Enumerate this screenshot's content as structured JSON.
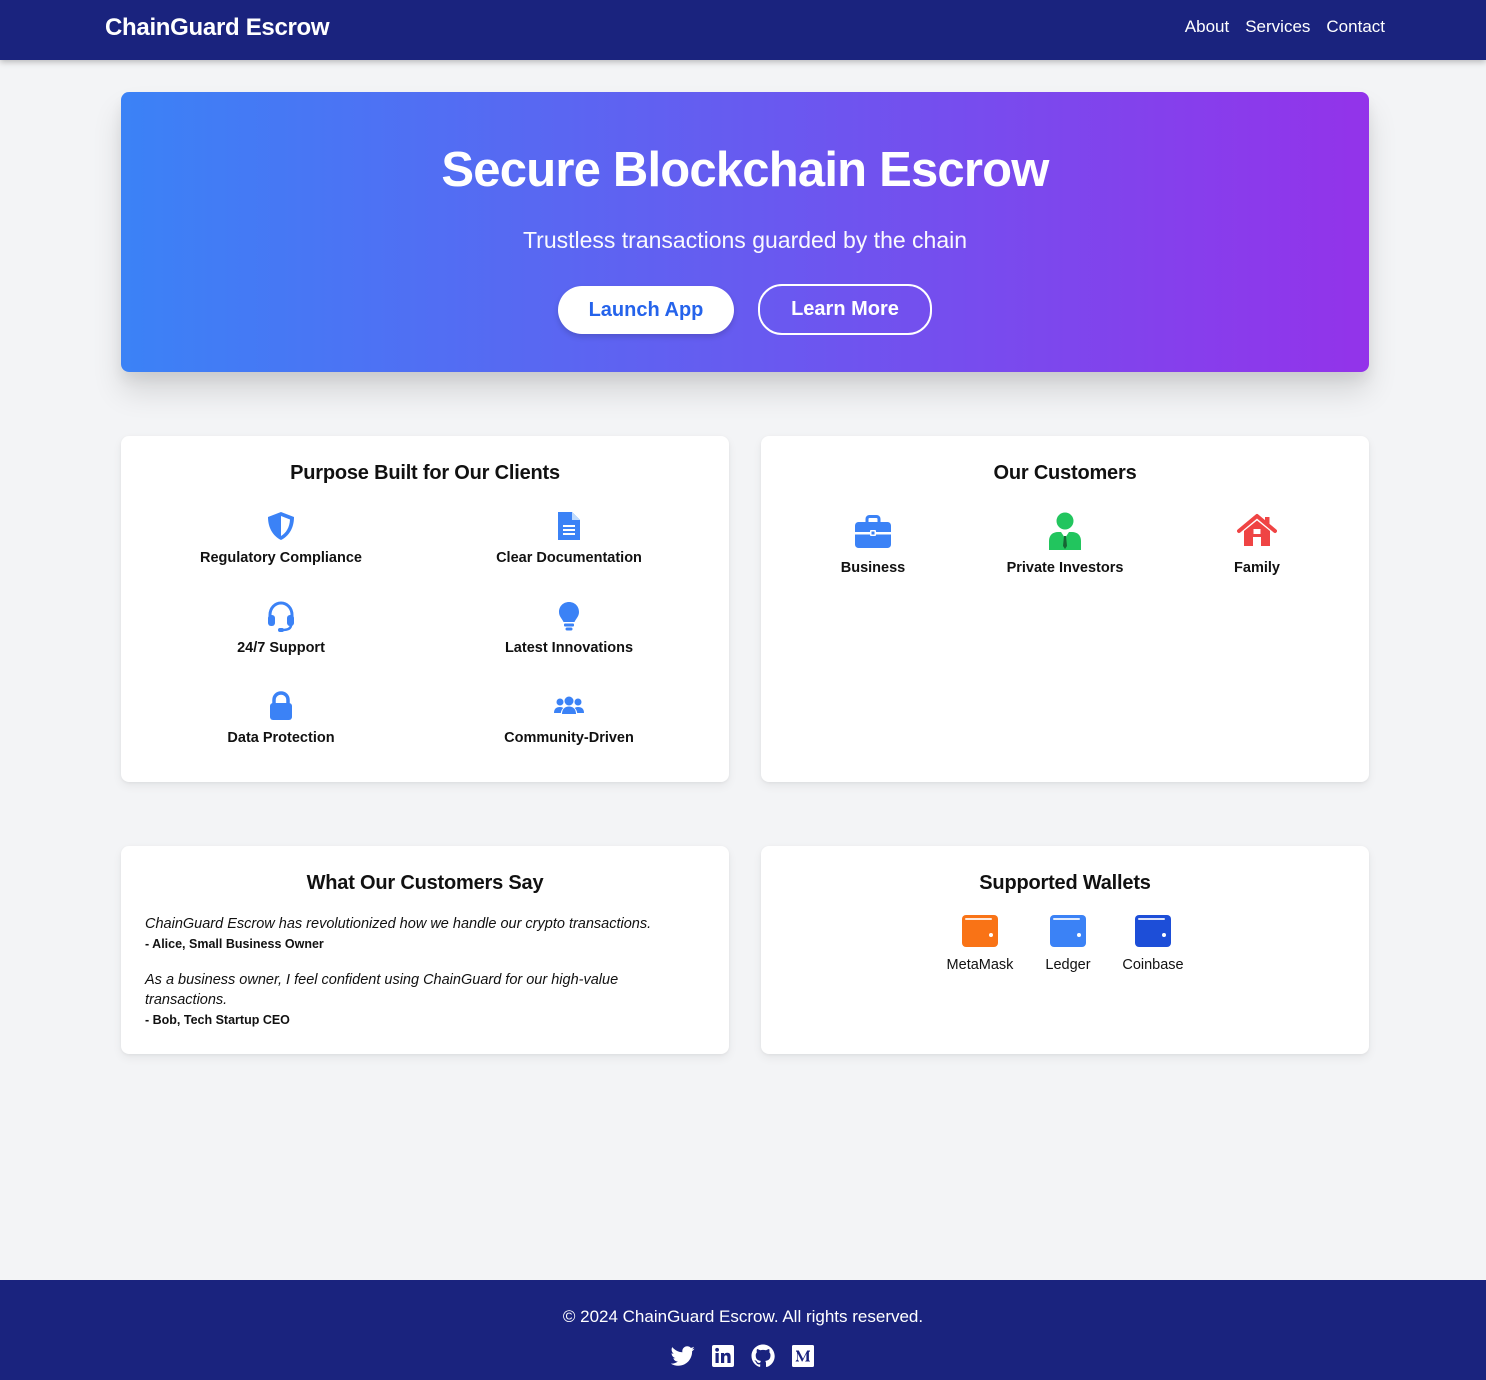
{
  "header": {
    "brand": "ChainGuard Escrow",
    "nav": [
      "About",
      "Services",
      "Contact"
    ]
  },
  "hero": {
    "title": "Secure Blockchain Escrow",
    "subtitle": "Trustless transactions guarded by the chain",
    "primary_button": "Launch App",
    "secondary_button": "Learn More",
    "gradient": [
      "#3b82f6",
      "#9333ea"
    ]
  },
  "features": {
    "title": "Purpose Built for Our Clients",
    "items": [
      {
        "label": "Regulatory Compliance",
        "icon": "shield-icon"
      },
      {
        "label": "Clear Documentation",
        "icon": "document-icon"
      },
      {
        "label": "24/7 Support",
        "icon": "headset-icon"
      },
      {
        "label": "Latest Innovations",
        "icon": "lightbulb-icon"
      },
      {
        "label": "Data Protection",
        "icon": "lock-icon"
      },
      {
        "label": "Community-Driven",
        "icon": "users-icon"
      }
    ],
    "icon_color": "#3b82f6"
  },
  "customers": {
    "title": "Our Customers",
    "items": [
      {
        "label": "Business",
        "icon": "briefcase-icon",
        "color": "#3b82f6"
      },
      {
        "label": "Private Investors",
        "icon": "investor-icon",
        "color": "#22c55e"
      },
      {
        "label": "Family",
        "icon": "home-icon",
        "color": "#ef4444"
      }
    ]
  },
  "testimonials": {
    "title": "What Our Customers Say",
    "items": [
      {
        "text": "ChainGuard Escrow has revolutionized how we handle our crypto transactions.",
        "author": "- Alice, Small Business Owner"
      },
      {
        "text": "As a business owner, I feel confident using ChainGuard for our high-value transactions.",
        "author": "- Bob, Tech Startup CEO"
      }
    ]
  },
  "wallets": {
    "title": "Supported Wallets",
    "items": [
      {
        "label": "MetaMask",
        "icon": "wallet-icon",
        "color": "#f97316"
      },
      {
        "label": "Ledger",
        "icon": "wallet-icon",
        "color": "#3b82f6"
      },
      {
        "label": "Coinbase",
        "icon": "wallet-icon",
        "color": "#1d4ed8"
      }
    ]
  },
  "footer": {
    "copyright": "© 2024 ChainGuard Escrow. All rights reserved.",
    "social": [
      "twitter-icon",
      "linkedin-icon",
      "github-icon",
      "medium-icon"
    ]
  },
  "colors": {
    "navbar": "#1a237e",
    "background": "#f3f4f6"
  }
}
